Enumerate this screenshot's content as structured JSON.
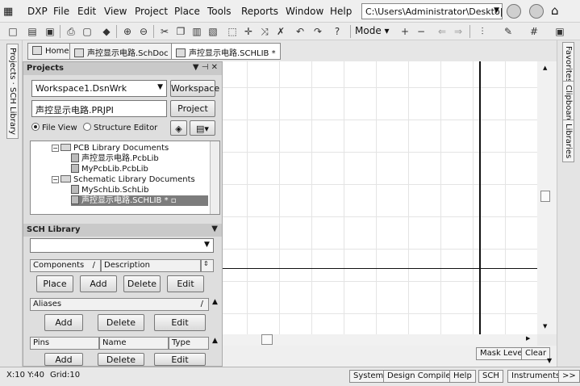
{
  "menubar": {
    "app": "DXP",
    "items": [
      "File",
      "Edit",
      "View",
      "Project",
      "Place",
      "Tools",
      "Reports",
      "Window",
      "Help"
    ],
    "path": "C:\\Users\\Administrator\\Deskto|"
  },
  "toolbar": {
    "mode_label": "Mode"
  },
  "left_rail": {
    "tabs": [
      "Projects",
      "SCH Library"
    ]
  },
  "right_rail": {
    "tabs": [
      "Favorites",
      "Clipboard",
      "Libraries"
    ]
  },
  "doc_tabs": [
    {
      "label": "Home"
    },
    {
      "label": "声控显示电路.SchDoc"
    },
    {
      "label": "声控显示电路.SCHLIB *"
    }
  ],
  "projects_panel": {
    "title": "Projects",
    "workspace_value": "Workspace1.DsnWrk",
    "workspace_button": "Workspace",
    "project_value": "声控显示电路.PRJPI",
    "project_button": "Project",
    "file_view": "File View",
    "structure_editor": "Structure Editor",
    "tree": [
      {
        "label": "PCB Library Documents",
        "kind": "folder"
      },
      {
        "label": "声控显示电路.PcbLib",
        "kind": "doc"
      },
      {
        "label": "MyPcbLib.PcbLib",
        "kind": "doc"
      },
      {
        "label": "Schematic Library Documents",
        "kind": "folder"
      },
      {
        "label": "MySchLib.SchLib",
        "kind": "doc"
      },
      {
        "label": "声控显示电路.SCHLIB *",
        "kind": "doc"
      }
    ]
  },
  "sch_library": {
    "title": "SCH Library",
    "filter_value": "",
    "components_header": [
      "Components",
      "Description"
    ],
    "component_buttons": [
      "Place",
      "Add",
      "Delete",
      "Edit"
    ],
    "aliases_header": "Aliases",
    "alias_buttons": [
      "Add",
      "Delete",
      "Edit"
    ],
    "pins_header": [
      "Pins",
      "Name",
      "Type"
    ],
    "pin_buttons": [
      "Add",
      "Delete",
      "Edit"
    ]
  },
  "canvas_footer": {
    "mask_level": "Mask Level",
    "clear": "Clear"
  },
  "statusbar": {
    "coords": "X:10 Y:40",
    "grid": "Grid:10",
    "buttons": [
      "System",
      "Design Compiler",
      "Help",
      "SCH",
      "Instruments",
      ">>"
    ]
  }
}
